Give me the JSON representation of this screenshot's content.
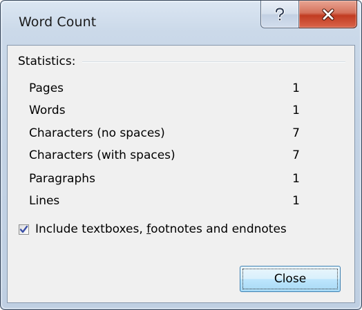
{
  "window": {
    "title": "Word Count",
    "help_glyph": "?",
    "close_glyph": "x"
  },
  "statistics": {
    "header": "Statistics:",
    "rows": [
      {
        "label": "Pages",
        "value": "1"
      },
      {
        "label": "Words",
        "value": "1"
      },
      {
        "label": "Characters (no spaces)",
        "value": "7"
      },
      {
        "label": "Characters (with spaces)",
        "value": "7"
      },
      {
        "label": "Paragraphs",
        "value": "1"
      },
      {
        "label": "Lines",
        "value": "1"
      }
    ]
  },
  "include_option": {
    "label_before": "Include textboxes, ",
    "label_accel": "f",
    "label_after": "ootnotes and endnotes",
    "checked": true
  },
  "buttons": {
    "close_label": "Close"
  },
  "icons": {
    "help": "question-mark-icon",
    "close": "close-x-icon",
    "check": "checkmark-icon"
  },
  "colors": {
    "close_caption": "#c13c22",
    "checkmark": "#3b4fa6",
    "button_border": "#3c7fb1"
  }
}
